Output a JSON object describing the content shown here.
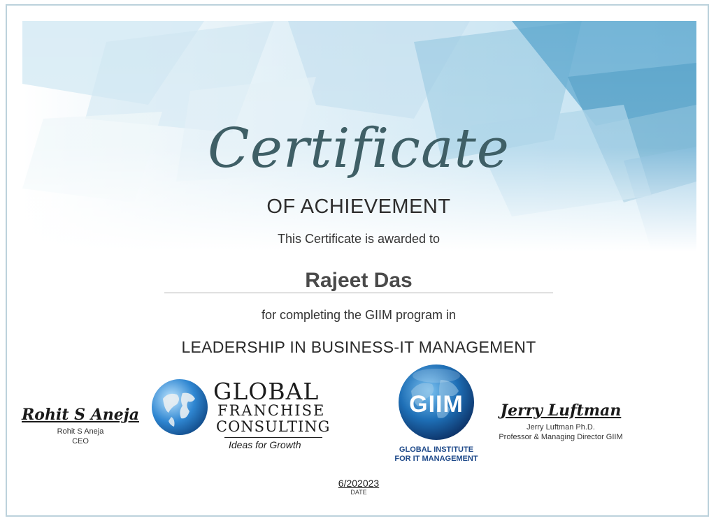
{
  "certificate": {
    "title": "Certificate",
    "subtitle": "OF ACHIEVEMENT",
    "awarded_text": "This Certificate is awarded to",
    "recipient": "Rajeet Das",
    "completion_text": "for completing the GIIM program in",
    "program": "LEADERSHIP IN BUSINESS-IT MANAGEMENT"
  },
  "signatories": {
    "left": {
      "signature": "Rohit S Aneja",
      "name": "Rohit S Aneja",
      "role": "CEO"
    },
    "right": {
      "signature": "Jerry Luftman",
      "name": "Jerry Luftman Ph.D.",
      "role": "Professor & Managing Director GIIM"
    }
  },
  "logos": {
    "gfc": {
      "line1": "GLOBAL",
      "line2": "FRANCHISE",
      "line3": "CONSULTING",
      "tagline": "Ideas for Growth"
    },
    "giim": {
      "badge": "GIIM",
      "caption1": "GLOBAL INSTITUTE",
      "caption2": "FOR IT MANAGEMENT"
    }
  },
  "date": {
    "value": "6/202023",
    "label": "DATE"
  },
  "colors": {
    "banner_light": "#e6f2f8",
    "banner_mid": "#a9d3e8",
    "banner_dark": "#4f9cc4",
    "title_color": "#3f5f66",
    "giim_blue": "#1f4a8a"
  }
}
